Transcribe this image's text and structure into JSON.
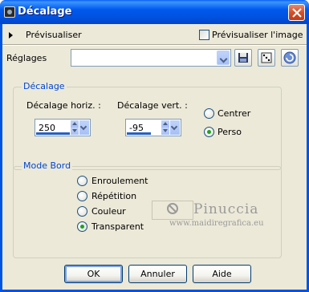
{
  "window": {
    "title": "Décalage"
  },
  "preview_bar": {
    "preview_label": "Prévisualiser",
    "checkbox_label": "Prévisualiser l'image",
    "checkbox_checked": false
  },
  "presets": {
    "label": "Réglages",
    "value": ""
  },
  "offset_group": {
    "title": "Décalage",
    "horiz_label": "Décalage horiz. :",
    "horiz_value": "250",
    "vert_label": "Décalage vert. :",
    "vert_value": "-95",
    "options": [
      {
        "label": "Centrer",
        "selected": false
      },
      {
        "label": "Perso",
        "selected": true
      }
    ]
  },
  "edge_group": {
    "title": "Mode Bord",
    "options": [
      {
        "label": "Enroulement",
        "selected": false
      },
      {
        "label": "Répétition",
        "selected": false
      },
      {
        "label": "Couleur",
        "selected": false
      },
      {
        "label": "Transparent",
        "selected": true
      }
    ]
  },
  "watermark": {
    "name": "Pinuccia",
    "url": "www.maidiregrafica.eu"
  },
  "buttons": {
    "ok": "OK",
    "cancel": "Annuler",
    "help": "Aide"
  },
  "colors": {
    "titlebar": "#0054e3",
    "group_label": "#0046d5",
    "client": "#ece9d8",
    "radio_on": "#21a121"
  }
}
